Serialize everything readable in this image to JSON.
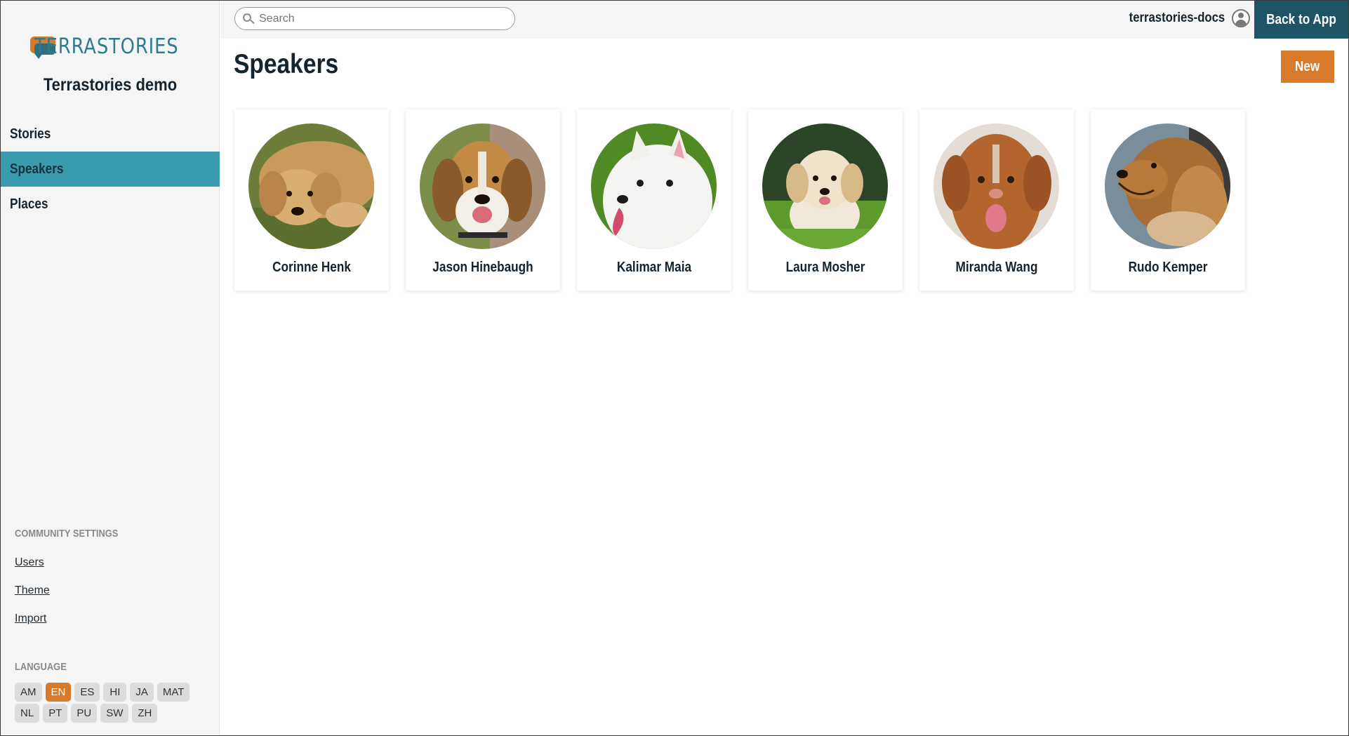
{
  "sidebar": {
    "logo_text": "TERRASTORIES",
    "site_name": "Terrastories demo",
    "nav": [
      {
        "label": "Stories",
        "active": false
      },
      {
        "label": "Speakers",
        "active": true
      },
      {
        "label": "Places",
        "active": false
      }
    ],
    "community_settings_label": "COMMUNITY SETTINGS",
    "settings_links": [
      "Users",
      "Theme",
      "Import"
    ],
    "language_label": "LANGUAGE",
    "languages_row1": [
      "AM",
      "EN",
      "ES",
      "HI",
      "JA",
      "MAT"
    ],
    "languages_row2": [
      "NL",
      "PT",
      "PU",
      "SW",
      "ZH"
    ],
    "active_language": "EN"
  },
  "topbar": {
    "search_placeholder": "Search",
    "username": "terrastories-docs",
    "back_label": "Back to App"
  },
  "main": {
    "title": "Speakers",
    "new_label": "New",
    "speakers": [
      {
        "name": "Corinne Henk",
        "photo": "golden-retriever-puppy-lying-on-grass"
      },
      {
        "name": "Jason Hinebaugh",
        "photo": "beagle-smiling"
      },
      {
        "name": "Kalimar Maia",
        "photo": "white-samoyed-tongue-out"
      },
      {
        "name": "Laura Mosher",
        "photo": "golden-puppy-in-grass"
      },
      {
        "name": "Miranda Wang",
        "photo": "toller-dog-smiling"
      },
      {
        "name": "Rudo Kemper",
        "photo": "cocker-spaniel-profile"
      }
    ]
  },
  "colors": {
    "accent_teal": "#3a9aae",
    "brand_orange": "#d9792a",
    "dark_blue": "#1f5466"
  }
}
